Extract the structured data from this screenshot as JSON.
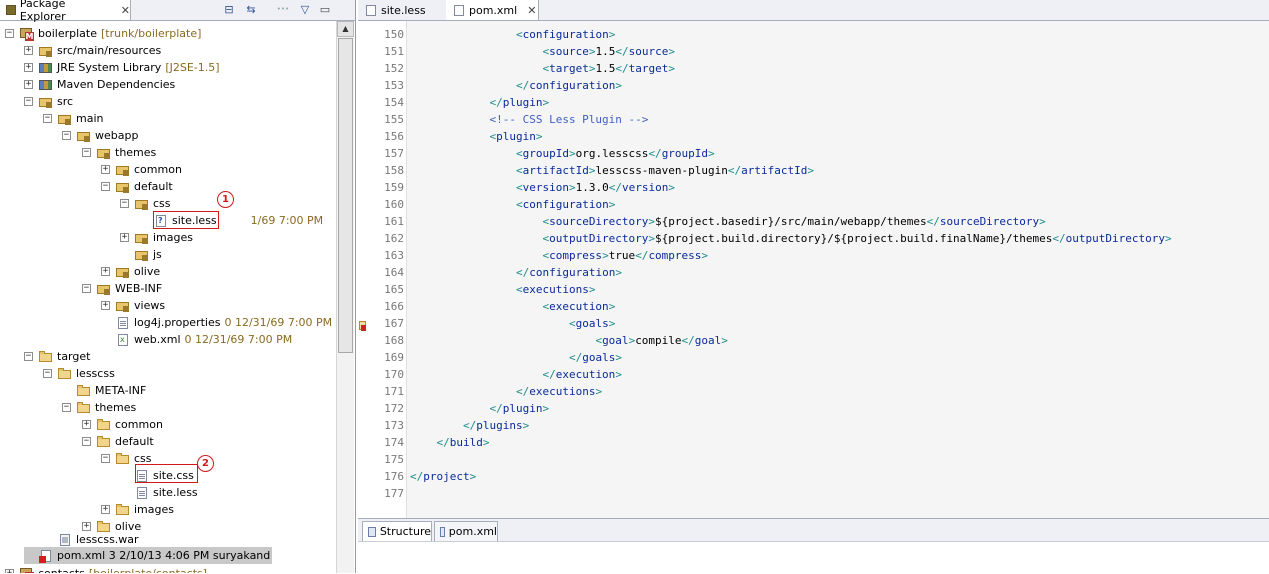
{
  "package_explorer": {
    "title": "Package Explorer",
    "close": "✕",
    "toolbar": {
      "collapse": "⊟",
      "link": "⇆",
      "filter": "•••",
      "menu": "▽"
    },
    "rows": [
      {
        "label": "boilerplate",
        "deco": "[trunk/boilerplate]",
        "icon": "project-icon",
        "exp": "−"
      },
      {
        "label": "src/main/resources",
        "deco": "",
        "icon": "package-folder-icon",
        "exp": "+"
      },
      {
        "label": "JRE System Library",
        "deco": "[J2SE-1.5]",
        "icon": "library-icon",
        "exp": "+"
      },
      {
        "label": "Maven Dependencies",
        "deco": "",
        "icon": "library-icon",
        "exp": "+"
      },
      {
        "label": "src",
        "deco": "",
        "icon": "package-folder-icon",
        "exp": "−"
      },
      {
        "label": "main",
        "deco": "",
        "icon": "package-folder-icon",
        "exp": "−"
      },
      {
        "label": "webapp",
        "deco": "",
        "icon": "package-folder-icon",
        "exp": "−"
      },
      {
        "label": "themes",
        "deco": "",
        "icon": "package-folder-icon",
        "exp": "−"
      },
      {
        "label": "common",
        "deco": "",
        "icon": "package-folder-icon",
        "exp": "+"
      },
      {
        "label": "default",
        "deco": "",
        "icon": "package-folder-icon",
        "exp": "−"
      },
      {
        "label": "css",
        "deco": "",
        "icon": "package-folder-icon",
        "exp": "−"
      },
      {
        "label": "site.less",
        "deco": "1/69 7:00 PM",
        "icon": "unversioned-file-icon",
        "exp": ""
      },
      {
        "label": "images",
        "deco": "",
        "icon": "package-folder-icon",
        "exp": "+"
      },
      {
        "label": "js",
        "deco": "",
        "icon": "package-folder-icon",
        "exp": ""
      },
      {
        "label": "olive",
        "deco": "",
        "icon": "package-folder-icon",
        "exp": "+"
      },
      {
        "label": "WEB-INF",
        "deco": "",
        "icon": "package-folder-icon",
        "exp": "−"
      },
      {
        "label": "views",
        "deco": "",
        "icon": "package-folder-icon",
        "exp": "+"
      },
      {
        "label": "log4j.properties",
        "deco": "0  12/31/69 7:00 PM",
        "icon": "properties-file-icon",
        "exp": ""
      },
      {
        "label": "web.xml",
        "deco": "0  12/31/69 7:00 PM",
        "icon": "xml-file-icon",
        "exp": ""
      },
      {
        "label": "target",
        "deco": "",
        "icon": "folder-icon",
        "exp": "−"
      },
      {
        "label": "lesscss",
        "deco": "",
        "icon": "folder-icon",
        "exp": "−"
      },
      {
        "label": "META-INF",
        "deco": "",
        "icon": "folder-icon",
        "exp": ""
      },
      {
        "label": "themes",
        "deco": "",
        "icon": "folder-icon",
        "exp": "−"
      },
      {
        "label": "common",
        "deco": "",
        "icon": "folder-icon",
        "exp": "+"
      },
      {
        "label": "default",
        "deco": "",
        "icon": "folder-icon",
        "exp": "−"
      },
      {
        "label": "css",
        "deco": "",
        "icon": "folder-icon",
        "exp": "−"
      },
      {
        "label": "site.css",
        "deco": "",
        "icon": "file-icon",
        "exp": ""
      },
      {
        "label": "site.less",
        "deco": "",
        "icon": "file-icon",
        "exp": ""
      },
      {
        "label": "images",
        "deco": "",
        "icon": "folder-icon",
        "exp": "+"
      },
      {
        "label": "olive",
        "deco": "",
        "icon": "folder-icon",
        "exp": "+"
      },
      {
        "label": "lesscss.war",
        "deco": "",
        "icon": "war-file-icon",
        "exp": ""
      },
      {
        "label": "pom.xml 3  2/10/13 4:06 PM  suryakand",
        "deco": "",
        "icon": "pom-error-icon",
        "exp": ""
      },
      {
        "label": "contacts",
        "deco": "[boilerplate/contacts]",
        "icon": "project-icon",
        "exp": "+"
      }
    ],
    "callouts": {
      "one": "1",
      "two": "2"
    }
  },
  "editor": {
    "tabs": [
      {
        "label": "site.less"
      },
      {
        "label": "pom.xml",
        "close": "✕"
      }
    ],
    "lines": [
      {
        "n": "150",
        "t": "                <configuration>"
      },
      {
        "n": "151",
        "t": "                    <source>1.5</source>"
      },
      {
        "n": "152",
        "t": "                    <target>1.5</target>"
      },
      {
        "n": "153",
        "t": "                </configuration>"
      },
      {
        "n": "154",
        "t": "            </plugin>"
      },
      {
        "n": "155",
        "t": "            <!-- CSS Less Plugin -->"
      },
      {
        "n": "156",
        "t": "            <plugin>"
      },
      {
        "n": "157",
        "t": "                <groupId>org.lesscss</groupId>"
      },
      {
        "n": "158",
        "t": "                <artifactId>lesscss-maven-plugin</artifactId>"
      },
      {
        "n": "159",
        "t": "                <version>1.3.0</version>"
      },
      {
        "n": "160",
        "t": "                <configuration>"
      },
      {
        "n": "161",
        "t": "                    <sourceDirectory>${project.basedir}/src/main/webapp/themes</sourceDirectory>"
      },
      {
        "n": "162",
        "t": "                    <outputDirectory>${project.build.directory}/${project.build.finalName}/themes</outputDirectory>"
      },
      {
        "n": "163",
        "t": "                    <compress>true</compress>"
      },
      {
        "n": "164",
        "t": "                </configuration>"
      },
      {
        "n": "165",
        "t": "                <executions>"
      },
      {
        "n": "166",
        "t": "                    <execution>"
      },
      {
        "n": "167",
        "t": "                        <goals>"
      },
      {
        "n": "168",
        "t": "                            <goal>compile</goal>"
      },
      {
        "n": "169",
        "t": "                        </goals>"
      },
      {
        "n": "170",
        "t": "                    </execution>"
      },
      {
        "n": "171",
        "t": "                </executions>"
      },
      {
        "n": "172",
        "t": "            </plugin>"
      },
      {
        "n": "173",
        "t": "        </plugins>"
      },
      {
        "n": "174",
        "t": "    </build>"
      },
      {
        "n": "175",
        "t": ""
      },
      {
        "n": "176",
        "t": "</project>"
      },
      {
        "n": "177",
        "t": ""
      }
    ]
  },
  "bottom": {
    "tabs": [
      {
        "label": "Structure"
      },
      {
        "label": "pom.xml"
      }
    ]
  }
}
